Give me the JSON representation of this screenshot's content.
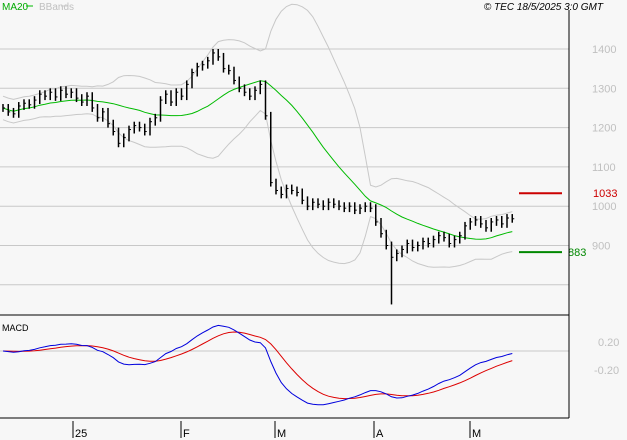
{
  "chart_data": {
    "type": "line",
    "title": "© TEC 18/5/2025 3:0 GMT",
    "legend": [
      {
        "name": "MA20",
        "color": "#00bb00"
      },
      {
        "name": "BBands",
        "color": "#c8c8c8"
      }
    ],
    "legend_placement": "top-left",
    "price_axis": {
      "ticks": [
        1400,
        1300,
        1200,
        1100,
        1000,
        900
      ],
      "ylim": [
        700,
        1525
      ]
    },
    "x_ticks": [
      "25",
      "F",
      "M",
      "A",
      "M"
    ],
    "x_tick_index": [
      14,
      34,
      52,
      71,
      89
    ],
    "closes": [
      1250,
      1240,
      1235,
      1255,
      1262,
      1258,
      1270,
      1285,
      1280,
      1290,
      1278,
      1295,
      1285,
      1290,
      1275,
      1265,
      1280,
      1250,
      1225,
      1240,
      1210,
      1190,
      1160,
      1175,
      1195,
      1205,
      1200,
      1190,
      1215,
      1225,
      1270,
      1285,
      1265,
      1290,
      1280,
      1310,
      1340,
      1355,
      1360,
      1370,
      1390,
      1380,
      1350,
      1345,
      1320,
      1300,
      1290,
      1280,
      1295,
      1310,
      1230,
      1060,
      1040,
      1030,
      1045,
      1040,
      1035,
      1015,
      1000,
      1010,
      1005,
      1000,
      1010,
      1005,
      1000,
      995,
      1000,
      990,
      995,
      1000,
      995,
      960,
      930,
      900,
      870,
      880,
      890,
      905,
      895,
      900,
      910,
      905,
      915,
      925,
      920,
      905,
      915,
      925,
      950,
      960,
      965,
      955,
      945,
      960,
      965,
      955,
      970,
      968
    ],
    "low_override": {
      "74": 750
    },
    "levels": [
      {
        "label": "1033",
        "value": 1033,
        "color": "#cc0000"
      },
      {
        "label": "883",
        "value": 883,
        "color": "#008800"
      }
    ],
    "macd": {
      "label": "MACD",
      "ticks": [
        "0.20",
        "-0.20"
      ],
      "macd_color": "#0000dd",
      "signal_color": "#dd0000"
    }
  }
}
